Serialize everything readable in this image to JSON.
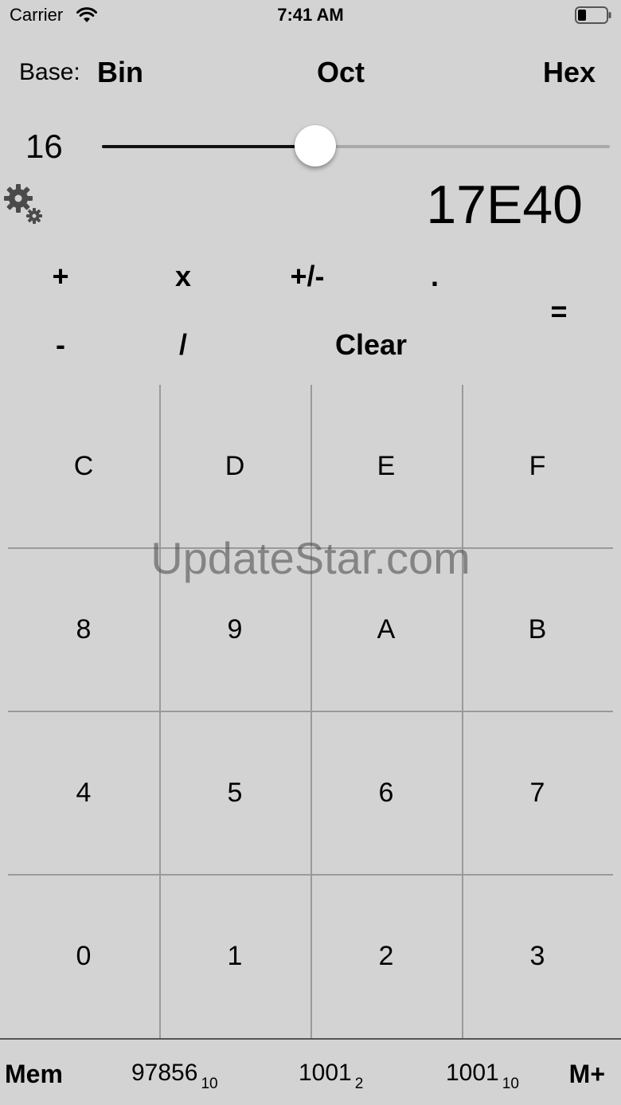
{
  "status_bar": {
    "carrier": "Carrier",
    "time": "7:41 AM",
    "wifi_icon": "wifi-icon",
    "battery_icon": "battery-icon"
  },
  "base": {
    "label": "Base:",
    "options": [
      "Bin",
      "Oct",
      "Hex"
    ]
  },
  "slider": {
    "value": "16",
    "fraction": 0.42
  },
  "settings_icon": "gear-icon",
  "display": "17E40",
  "operators": {
    "plus": "+",
    "times": "x",
    "plusminus": "+/-",
    "dot": ".",
    "equals": "=",
    "minus": "-",
    "divide": "/",
    "clear": "Clear"
  },
  "keypad": {
    "rows": [
      [
        "C",
        "D",
        "E",
        "F"
      ],
      [
        "8",
        "9",
        "A",
        "B"
      ],
      [
        "4",
        "5",
        "6",
        "7"
      ],
      [
        "0",
        "1",
        "2",
        "3"
      ]
    ]
  },
  "watermark": "UpdateStar.com",
  "memory": {
    "mem_label": "Mem",
    "mem_plus_label": "M+",
    "items": [
      {
        "value": "97856",
        "base": "10"
      },
      {
        "value": "1001",
        "base": "2"
      },
      {
        "value": "1001",
        "base": "10"
      }
    ]
  }
}
